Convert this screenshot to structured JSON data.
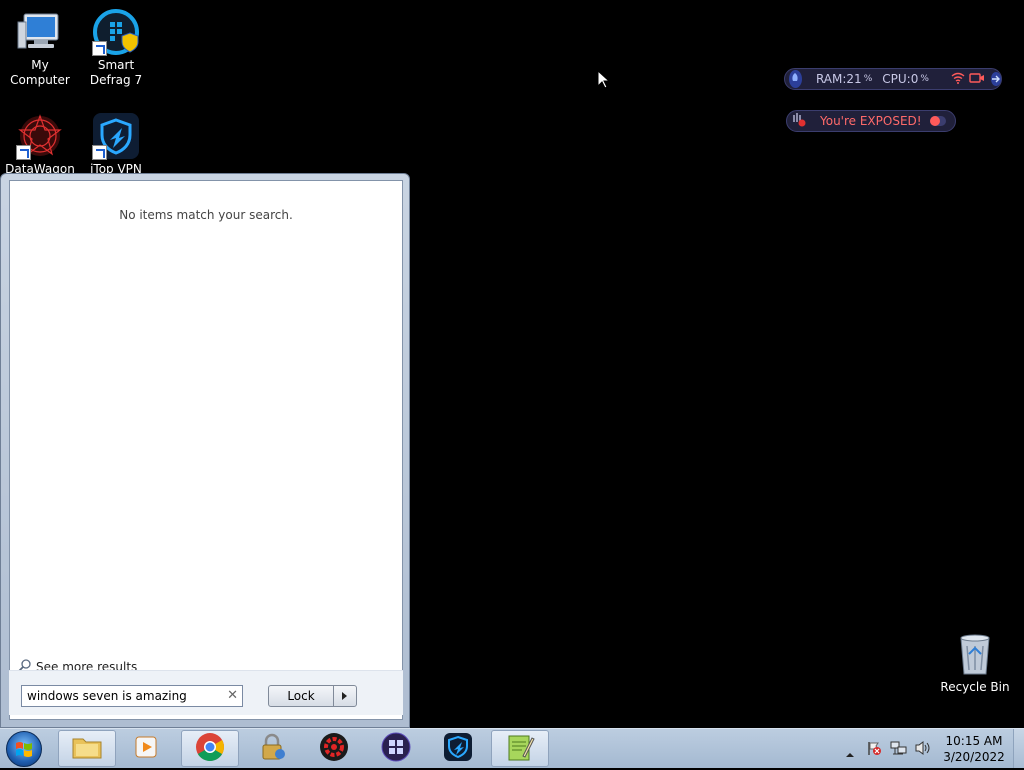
{
  "desktop": {
    "icons": [
      {
        "label": "My Computer"
      },
      {
        "label": "Smart Defrag 7"
      },
      {
        "label": "DataWagon"
      },
      {
        "label": "iTop VPN"
      },
      {
        "label": "Recycle Bin"
      }
    ]
  },
  "gadgets": {
    "system_monitor": {
      "ram_label": "RAM:",
      "ram_value": "21",
      "ram_unit": "%",
      "cpu_label": "CPU:",
      "cpu_value": "0",
      "cpu_unit": "%"
    },
    "exposure": {
      "status_text": "You're EXPOSED!",
      "status_color": "#ff5a5a"
    }
  },
  "start_menu": {
    "no_results_text": "No items match your search.",
    "see_more_label": "See more results",
    "search_value": "windows seven is amazing",
    "power_button_label": "Lock"
  },
  "taskbar": {
    "pinned": [
      {
        "icon": "windows-explorer-icon"
      },
      {
        "icon": "media-player-icon"
      },
      {
        "icon": "chrome-icon"
      },
      {
        "icon": "lock-security-icon"
      },
      {
        "icon": "red-gear-app-icon"
      },
      {
        "icon": "windows-tool-icon"
      },
      {
        "icon": "itop-vpn-icon"
      },
      {
        "icon": "notepad-plus-plus-icon"
      }
    ],
    "clock": {
      "time": "10:15 AM",
      "date": "3/20/2022"
    }
  }
}
